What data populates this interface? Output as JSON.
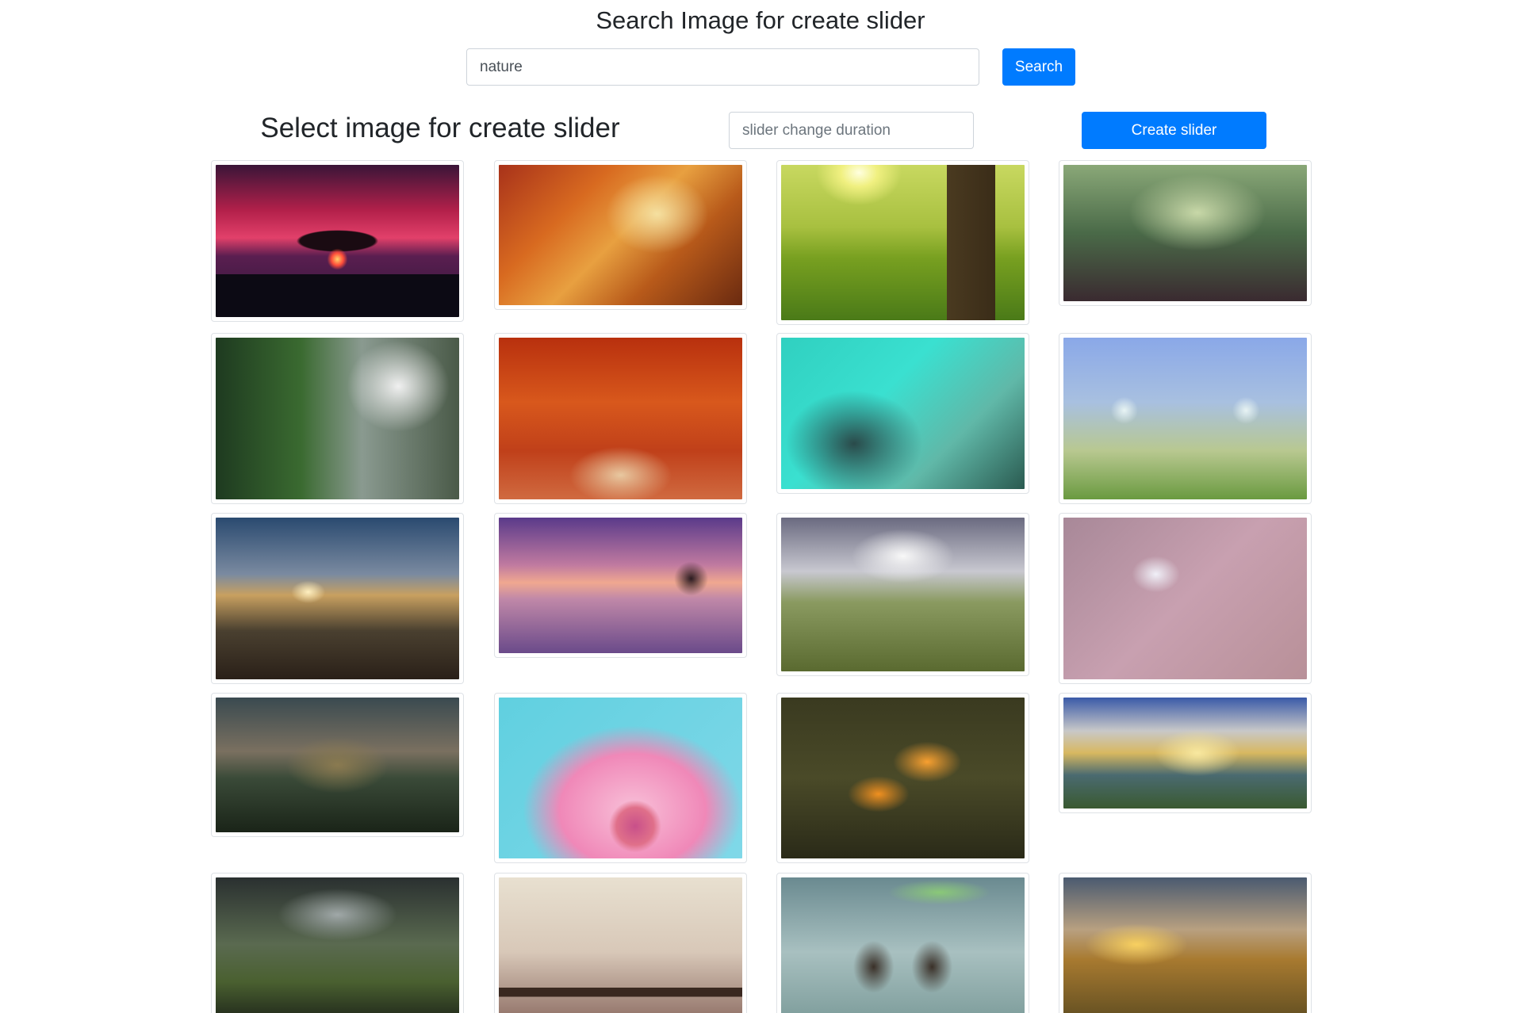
{
  "header": {
    "title": "Search Image for create slider"
  },
  "search": {
    "value": "nature",
    "button_label": "Search"
  },
  "slider": {
    "section_title": "Select image for create slider",
    "duration_placeholder": "slider change duration",
    "duration_value": "",
    "create_button_label": "Create slider"
  },
  "gallery": {
    "columns": 4,
    "images": [
      {
        "name": "tree-sunset-image"
      },
      {
        "name": "autumn-forest-path-image"
      },
      {
        "name": "sunlit-meadow-image"
      },
      {
        "name": "misty-forest-image"
      },
      {
        "name": "forest-road-image"
      },
      {
        "name": "red-autumn-trees-image"
      },
      {
        "name": "dandelion-dew-image"
      },
      {
        "name": "butterflies-flowers-image"
      },
      {
        "name": "mountain-sunrise-image"
      },
      {
        "name": "lake-tree-dusk-image"
      },
      {
        "name": "railway-clouds-image"
      },
      {
        "name": "bird-branch-image"
      },
      {
        "name": "lake-island-image"
      },
      {
        "name": "pink-flower-image"
      },
      {
        "name": "orange-flowers-butterfly-image"
      },
      {
        "name": "sunrays-hills-image"
      },
      {
        "name": "misty-valley-image"
      },
      {
        "name": "foggy-pier-image"
      },
      {
        "name": "children-leaf-umbrella-image"
      },
      {
        "name": "sunset-hills-image"
      }
    ]
  }
}
